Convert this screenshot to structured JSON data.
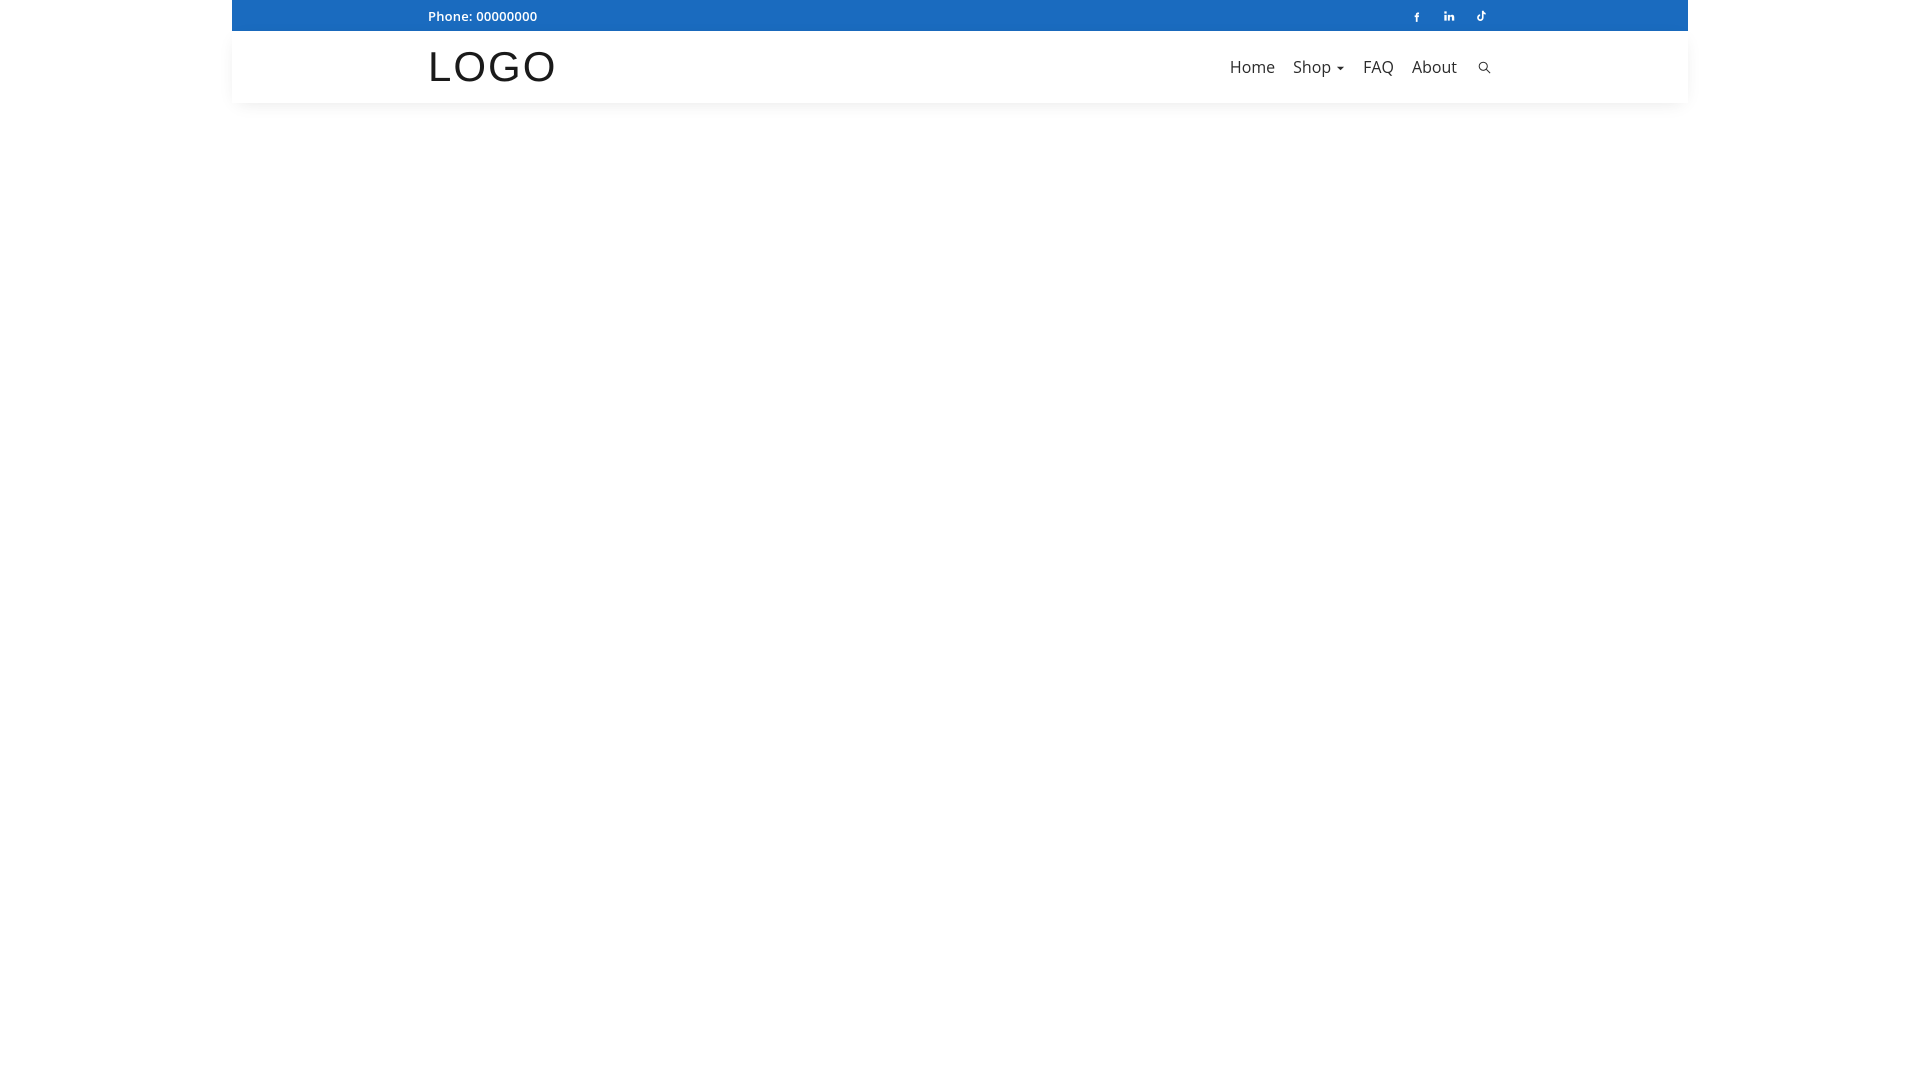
{
  "topbar": {
    "phone_text": "Phone: 00000000",
    "social": [
      {
        "name": "facebook"
      },
      {
        "name": "linkedin"
      },
      {
        "name": "tiktok"
      }
    ]
  },
  "header": {
    "logo_text": "LOGO",
    "nav": [
      {
        "label": "Home",
        "has_submenu": false
      },
      {
        "label": "Shop",
        "has_submenu": true
      },
      {
        "label": "FAQ",
        "has_submenu": false
      },
      {
        "label": "About",
        "has_submenu": false
      }
    ]
  },
  "colors": {
    "topbar_bg": "#1a6bbf",
    "text_dark": "#2b2b2b"
  }
}
